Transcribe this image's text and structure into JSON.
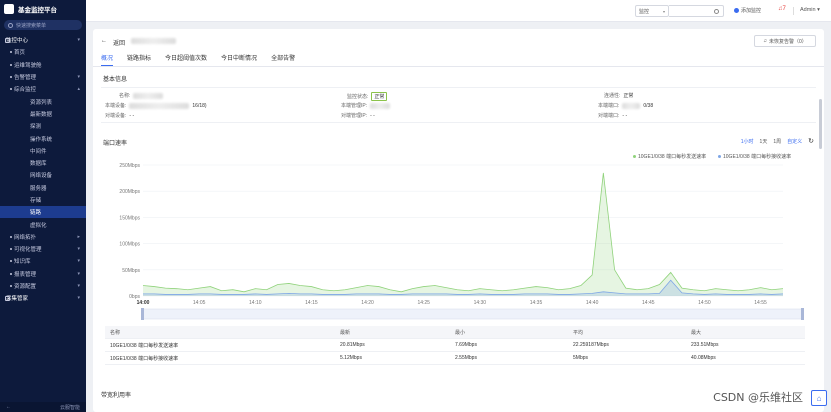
{
  "sidebar": {
    "title": "基金监控平台",
    "search_placeholder": "快速搜索菜单",
    "items": [
      {
        "label": "监控中心",
        "level": 0,
        "chevron": "▾"
      },
      {
        "label": "首页",
        "level": 1,
        "chevron": ""
      },
      {
        "label": "运维驾驶舱",
        "level": 1,
        "chevron": ""
      },
      {
        "label": "告警管理",
        "level": 1,
        "chevron": "▾"
      },
      {
        "label": "综合监控",
        "level": 1,
        "chevron": "▴"
      },
      {
        "label": "资源列表",
        "level": 2,
        "chevron": ""
      },
      {
        "label": "最新数据",
        "level": 2,
        "chevron": ""
      },
      {
        "label": "探测",
        "level": 2,
        "chevron": ""
      },
      {
        "label": "操作系统",
        "level": 2,
        "chevron": ""
      },
      {
        "label": "中间件",
        "level": 2,
        "chevron": ""
      },
      {
        "label": "数据库",
        "level": 2,
        "chevron": ""
      },
      {
        "label": "网络设备",
        "level": 2,
        "chevron": ""
      },
      {
        "label": "服务器",
        "level": 2,
        "chevron": ""
      },
      {
        "label": "存储",
        "level": 2,
        "chevron": ""
      },
      {
        "label": "链路",
        "level": 2,
        "chevron": "",
        "active": true
      },
      {
        "label": "虚拟化",
        "level": 2,
        "chevron": ""
      },
      {
        "label": "网络拓扑",
        "level": 1,
        "chevron": "▸"
      },
      {
        "label": "可视化管理",
        "level": 1,
        "chevron": "▾"
      },
      {
        "label": "知识库",
        "level": 1,
        "chevron": "▾"
      },
      {
        "label": "报表管理",
        "level": 1,
        "chevron": "▾"
      },
      {
        "label": "资源配置",
        "level": 1,
        "chevron": "▾"
      },
      {
        "label": "采集管家",
        "level": 0,
        "chevron": "▾"
      }
    ],
    "footer_left": "←",
    "footer_right": "云服智能"
  },
  "topbar": {
    "select_value": "监控",
    "add_label": "添加监控",
    "bell_count": "7",
    "user": "Admin"
  },
  "page": {
    "back_label": "返回",
    "alarm_button": "未恢复告警（0）",
    "tabs": [
      "概况",
      "链路指标",
      "今日超阈值次数",
      "今日中断情况",
      "全部告警"
    ],
    "basic_info_title": "基本信息",
    "info": {
      "name_label": "名称:",
      "local_device_label": "本端设备:",
      "local_device_suffix": "16/18)",
      "peer_device_label": "对端设备:",
      "peer_device_value": "- -",
      "monitor_status_label": "监控状态:",
      "monitor_status_value": "正常",
      "local_mgmt_ip_label": "本端管理IP:",
      "peer_mgmt_ip_label": "对端管理IP:",
      "peer_mgmt_ip_value": "- -",
      "connectivity_label": "连通性:",
      "connectivity_value": "正常",
      "local_port_label": "本端端口:",
      "local_port_value": "0/38",
      "peer_port_label": "对端端口:",
      "peer_port_value": "- -"
    },
    "port_rate_title": "端口速率",
    "time_buttons": [
      "1小时",
      "1天",
      "1周",
      "自定义"
    ],
    "refresh_icon": "↻",
    "bandwidth_title": "带宽利用率",
    "watermark": "CSDN @乐维社区"
  },
  "chart_data": {
    "type": "area",
    "title": "",
    "ylabel": "",
    "yticks": [
      "0bps",
      "50Mbps",
      "100Mbps",
      "150Mbps",
      "200Mbps",
      "250Mbps"
    ],
    "ylim": [
      0,
      250
    ],
    "xticks": [
      "14:00",
      "14:05",
      "14:10",
      "14:15",
      "14:20",
      "14:25",
      "14:30",
      "14:35",
      "14:40",
      "14:45",
      "14:50",
      "14:55"
    ],
    "x_minutes": [
      0,
      1,
      2,
      3,
      4,
      5,
      6,
      7,
      8,
      9,
      10,
      11,
      12,
      13,
      14,
      15,
      16,
      17,
      18,
      19,
      20,
      21,
      22,
      23,
      24,
      25,
      26,
      27,
      28,
      29,
      30,
      31,
      32,
      33,
      34,
      35,
      36,
      37,
      38,
      39,
      40,
      41,
      42,
      43,
      44,
      45,
      46,
      47,
      48,
      49,
      50,
      51,
      52,
      53,
      54,
      55,
      56,
      57
    ],
    "grid": true,
    "legend_position": "top-right",
    "series": [
      {
        "name": "10GE1/0/38 端口每秒发送速率",
        "color": "#8fd27a",
        "values": [
          20,
          18,
          15,
          14,
          12,
          15,
          18,
          10,
          12,
          8,
          14,
          12,
          22,
          24,
          20,
          18,
          12,
          10,
          12,
          16,
          20,
          18,
          12,
          8,
          14,
          18,
          20,
          16,
          12,
          10,
          14,
          12,
          10,
          12,
          15,
          18,
          16,
          12,
          14,
          20,
          40,
          235,
          50,
          15,
          12,
          14,
          22,
          45,
          15,
          12,
          10,
          14,
          12,
          10,
          12,
          16,
          12,
          14
        ]
      },
      {
        "name": "10GE1/0/38 端口每秒接收速率",
        "color": "#7ea6e6",
        "values": [
          4,
          4,
          3,
          3,
          3,
          4,
          4,
          3,
          3,
          3,
          4,
          3,
          4,
          5,
          4,
          4,
          3,
          3,
          3,
          4,
          4,
          4,
          3,
          3,
          4,
          4,
          4,
          4,
          3,
          3,
          4,
          3,
          3,
          3,
          4,
          4,
          4,
          3,
          3,
          4,
          5,
          8,
          6,
          4,
          4,
          4,
          5,
          30,
          6,
          4,
          3,
          4,
          3,
          3,
          3,
          4,
          3,
          4
        ]
      }
    ]
  },
  "table": {
    "headers": [
      "名称",
      "最新",
      "最小",
      "平均",
      "最大"
    ],
    "rows": [
      [
        "10GE1/0/38 端口每秒发送速率",
        "20.81Mbps",
        "7.69Mbps",
        "22.259187Mbps",
        "233.51Mbps"
      ],
      [
        "10GE1/0/38 端口每秒接收速率",
        "5.12Mbps",
        "2.55Mbps",
        "5Mbps",
        "40.08Mbps"
      ]
    ]
  }
}
